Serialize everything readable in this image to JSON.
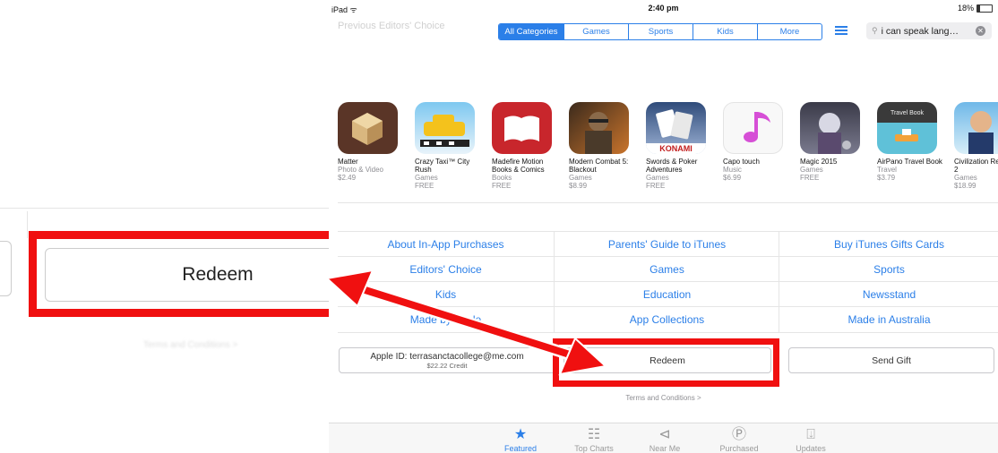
{
  "status_bar": {
    "device": "iPad",
    "time": "2:40 pm",
    "battery": "18%"
  },
  "header": {
    "ghost_title": "Previous Editors' Choice",
    "tabs": [
      {
        "label": "All Categories",
        "selected": true
      },
      {
        "label": "Games",
        "selected": false
      },
      {
        "label": "Sports",
        "selected": false
      },
      {
        "label": "Kids",
        "selected": false
      },
      {
        "label": "More",
        "selected": false
      }
    ],
    "search_value": "i can speak lang…"
  },
  "apps": [
    {
      "name": "Matter",
      "category": "Photo & Video",
      "price": "$2.49",
      "icon": "cube-icon"
    },
    {
      "name": "Crazy Taxi™ City Rush",
      "category": "Games",
      "price": "FREE",
      "icon": "taxi-icon"
    },
    {
      "name": "Madefire Motion Books & Comics",
      "category": "Books",
      "price": "FREE",
      "icon": "book-icon"
    },
    {
      "name": "Modern Combat 5: Blackout",
      "category": "Games",
      "price": "$8.99",
      "icon": "soldier-icon"
    },
    {
      "name": "Swords & Poker Adventures",
      "category": "Games",
      "price": "FREE",
      "icon": "poker-icon",
      "badge": "KONAMI"
    },
    {
      "name": "Capo touch",
      "category": "Music",
      "price": "$6.99",
      "icon": "music-note-icon"
    },
    {
      "name": "Magic 2015",
      "category": "Games",
      "price": "FREE",
      "icon": "magic-icon"
    },
    {
      "name": "AirPano Travel Book",
      "category": "Travel",
      "price": "$3.79",
      "icon": "travel-icon",
      "badge": "Travel Book"
    },
    {
      "name": "Civilization Revolution 2",
      "category": "Games",
      "price": "$18.99",
      "icon": "leader-icon"
    }
  ],
  "quick_links": [
    [
      "About In-App Purchases",
      "Parents' Guide to iTunes",
      "Buy iTunes Gifts Cards"
    ],
    [
      "Editors' Choice",
      "Games",
      "Sports"
    ],
    [
      "Kids",
      "Education",
      "Newsstand"
    ],
    [
      "Made by Apple",
      "App Collections",
      "Made in Australia"
    ]
  ],
  "account": {
    "apple_id": "Apple ID: terrasanctacollege@me.com",
    "credit": "$22.22 Credit",
    "redeem_label": "Redeem",
    "send_gift_label": "Send Gift",
    "terms": "Terms and Conditions >"
  },
  "tabbar": [
    {
      "label": "Featured",
      "icon": "star-icon",
      "active": true
    },
    {
      "label": "Top Charts",
      "icon": "list-icon",
      "active": false
    },
    {
      "label": "Near Me",
      "icon": "location-icon",
      "active": false
    },
    {
      "label": "Purchased",
      "icon": "purchased-icon",
      "active": false
    },
    {
      "label": "Updates",
      "icon": "updates-icon",
      "active": false
    }
  ],
  "zoom_callout": {
    "redeem_label": "Redeem",
    "terms_blur": "Terms and Conditions >"
  },
  "colors": {
    "accent": "#2b7fe8",
    "highlight": "#f01010"
  }
}
